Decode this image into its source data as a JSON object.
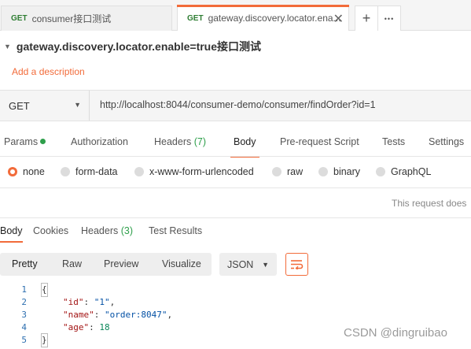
{
  "tabs": [
    {
      "method": "GET",
      "title": "consumer接口测试"
    },
    {
      "method": "GET",
      "title": "gateway.discovery.locator.ena..."
    }
  ],
  "tab_actions": {
    "new": "+",
    "more": "•••"
  },
  "request": {
    "title": "gateway.discovery.locator.enable=true接口测试",
    "add_description": "Add a description",
    "method": "GET",
    "url": "http://localhost:8044/consumer-demo/consumer/findOrder?id=1"
  },
  "request_tabs": {
    "params": "Params",
    "authorization": "Authorization",
    "headers": "Headers",
    "headers_count": "(7)",
    "body": "Body",
    "prerequest": "Pre-request Script",
    "tests": "Tests",
    "settings": "Settings"
  },
  "body_types": {
    "none": "none",
    "form_data": "form-data",
    "urlencoded": "x-www-form-urlencoded",
    "raw": "raw",
    "binary": "binary",
    "graphql": "GraphQL"
  },
  "request_empty_note": "This request does",
  "response_tabs": {
    "body": "Body",
    "cookies": "Cookies",
    "headers": "Headers",
    "headers_count": "(3)",
    "test_results": "Test Results"
  },
  "response_view": {
    "pretty": "Pretty",
    "raw": "Raw",
    "preview": "Preview",
    "visualize": "Visualize",
    "format": "JSON"
  },
  "response_body": {
    "line_numbers": [
      "1",
      "2",
      "3",
      "4",
      "5"
    ],
    "open_brace": "{",
    "close_brace": "}",
    "fields": [
      {
        "key": "\"id\"",
        "value": "\"1\"",
        "sep": ","
      },
      {
        "key": "\"name\"",
        "value": "\"order:8047\"",
        "sep": ","
      },
      {
        "key": "\"age\"",
        "value": "18",
        "sep": ""
      }
    ]
  },
  "watermark": "CSDN @dingruibao",
  "colors": {
    "accent": "#f26b3a",
    "success": "#2e9f4b",
    "get": "#2e7d32"
  }
}
